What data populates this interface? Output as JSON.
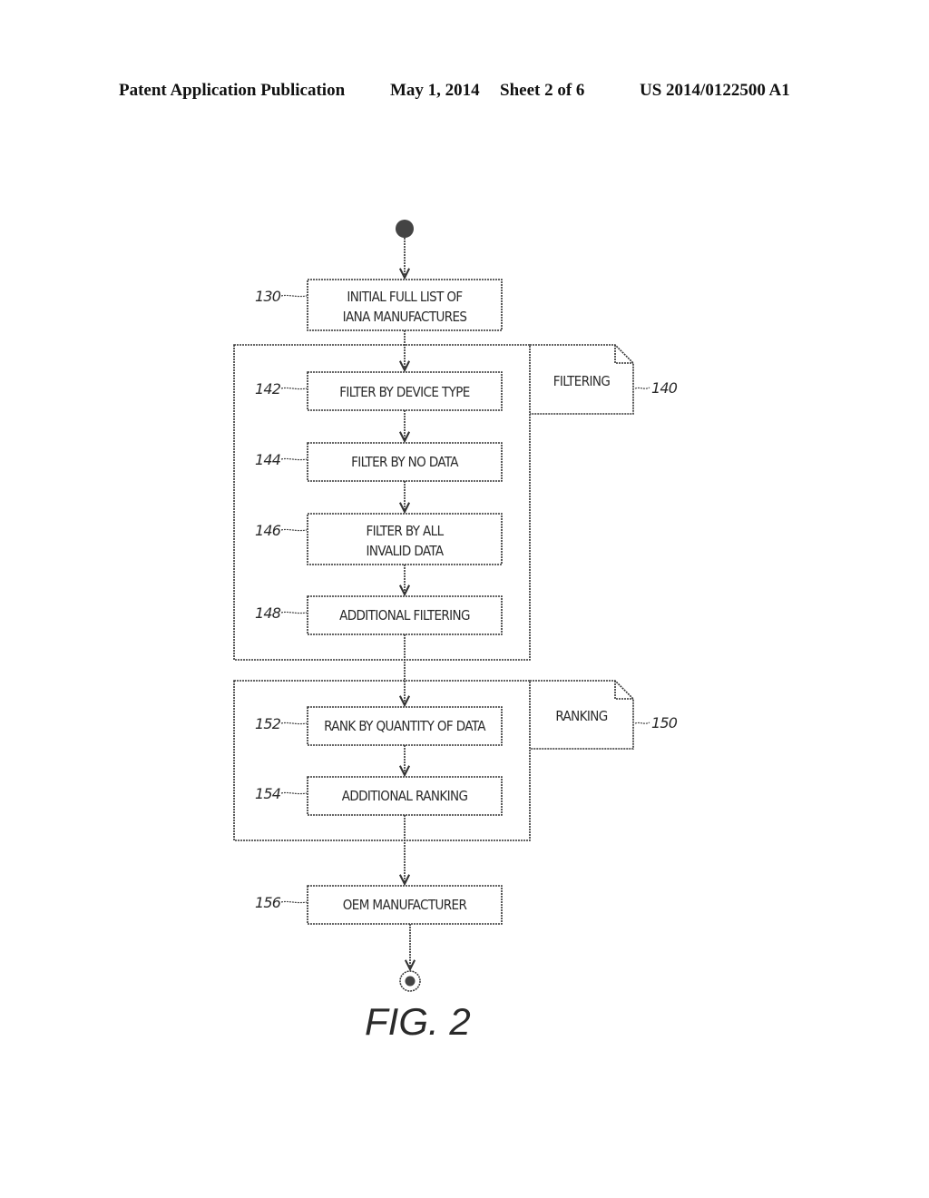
{
  "header": {
    "publication": "Patent Application Publication",
    "date": "May 1, 2014",
    "sheet": "Sheet 2 of 6",
    "number": "US 2014/0122500 A1"
  },
  "diagram": {
    "figure_label": "FIG. 2",
    "steps": [
      {
        "ref": "130",
        "lines": [
          "INITIAL FULL LIST OF",
          "IANA MANUFACTURES"
        ]
      },
      {
        "ref": "142",
        "lines": [
          "FILTER BY DEVICE TYPE"
        ]
      },
      {
        "ref": "144",
        "lines": [
          "FILTER BY NO DATA"
        ]
      },
      {
        "ref": "146",
        "lines": [
          "FILTER BY ALL",
          "INVALID DATA"
        ]
      },
      {
        "ref": "148",
        "lines": [
          "ADDITIONAL FILTERING"
        ]
      },
      {
        "ref": "152",
        "lines": [
          "RANK BY QUANTITY OF DATA"
        ]
      },
      {
        "ref": "154",
        "lines": [
          "ADDITIONAL RANKING"
        ]
      },
      {
        "ref": "156",
        "lines": [
          "OEM MANUFACTURER"
        ]
      }
    ],
    "groups": [
      {
        "ref": "140",
        "label": "FILTERING"
      },
      {
        "ref": "150",
        "label": "RANKING"
      }
    ]
  }
}
